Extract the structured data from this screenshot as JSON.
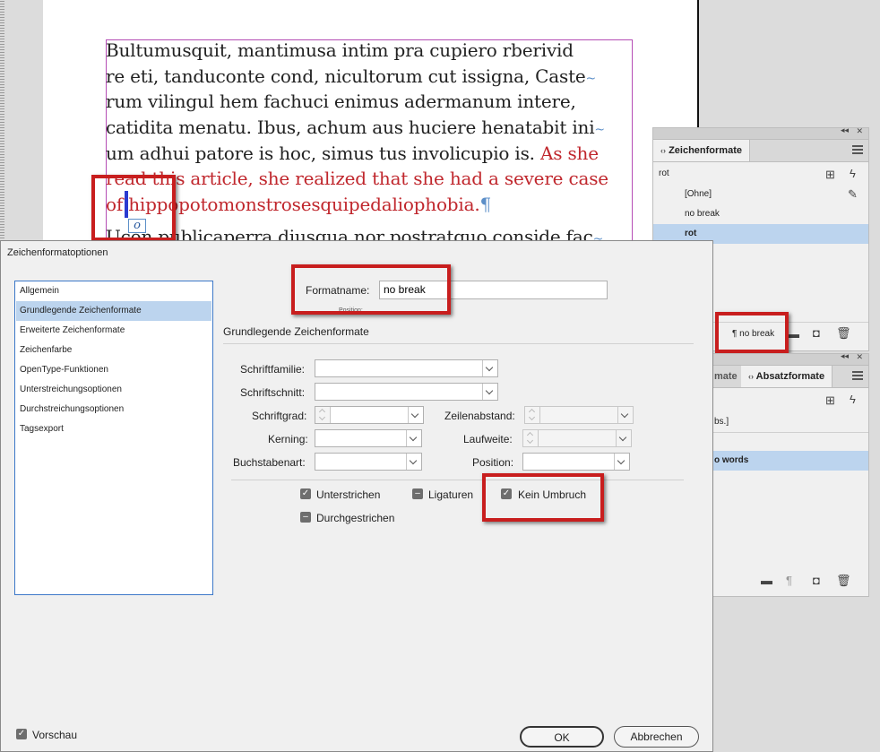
{
  "document": {
    "lines": [
      {
        "segments": [
          {
            "t": "Bultumusquit, mantimusa intim pra cupiero rberivid",
            "red": false
          }
        ]
      },
      {
        "segments": [
          {
            "t": "re eti, tanduconte cond, nicultorum cut issigna, Caste",
            "red": false
          },
          {
            "t": "~",
            "hyph": true
          }
        ]
      },
      {
        "segments": [
          {
            "t": "rum vilingul hem fachuci enimus adermanum intere,",
            "red": false
          }
        ]
      },
      {
        "segments": [
          {
            "t": "catidita menatu. Ibus, achum aus huciere henatabit ini",
            "red": false
          },
          {
            "t": "~",
            "hyph": true
          }
        ]
      },
      {
        "segments": [
          {
            "t": "um adhui patore is hoc, simus tus involicupio is. ",
            "red": false
          },
          {
            "t": "As she",
            "red": true
          }
        ]
      },
      {
        "segments": [
          {
            "t": "read this article, she realized that she had a severe case",
            "red": true
          }
        ]
      },
      {
        "segments": [
          {
            "t": "of hippopotomonstrosesquipedaliophobia.",
            "red": true
          },
          {
            "t": "¶",
            "pil": true
          }
        ]
      },
      {
        "segments": [
          {
            "t": "Ucon publicaperra diusqua nor postratquo conside fac",
            "red": false
          },
          {
            "t": "~",
            "hyph": true
          }
        ]
      }
    ],
    "anchor_glyph": "o"
  },
  "char_panel": {
    "tab_label": "Zeichenformate",
    "current_style": "rot",
    "items": [
      "[Ohne]",
      "no break",
      "rot"
    ],
    "selected_index": 2,
    "footer_label": "¶ no break"
  },
  "para_panel": {
    "tab_inactive": "mate",
    "tab_label": "Absatzformate",
    "row1": "bs.]",
    "row_selected": "o words"
  },
  "dialog": {
    "title": "Zeichenformatoptionen",
    "categories": [
      "Allgemein",
      "Grundlegende Zeichenformate",
      "Erweiterte Zeichenformate",
      "Zeichenfarbe",
      "OpenType-Funktionen",
      "Unterstreichungsoptionen",
      "Durchstreichungsoptionen",
      "Tagsexport"
    ],
    "selected_category": 1,
    "formatname_label": "Formatname:",
    "formatname_value": "no break",
    "position_small": "Position:",
    "section_title": "Grundlegende Zeichenformate",
    "fields": {
      "schriftfamilie": "Schriftfamilie:",
      "schriftschnitt": "Schriftschnitt:",
      "schriftgrad": "Schriftgrad:",
      "zeilenabstand": "Zeilenabstand:",
      "kerning": "Kerning:",
      "laufweite": "Laufweite:",
      "buchstabenart": "Buchstabenart:",
      "position": "Position:"
    },
    "checks": {
      "unterstrichen": "Unterstrichen",
      "ligaturen": "Ligaturen",
      "kein_umbruch": "Kein Umbruch",
      "durchgestrichen": "Durchgestrichen"
    },
    "vorschau": "Vorschau",
    "ok": "OK",
    "abbrechen": "Abbrechen"
  },
  "glyphs": {
    "check": "✓",
    "mixed": "–",
    "collapse": "◂◂",
    "close": "✕",
    "chevron": "‹›"
  }
}
